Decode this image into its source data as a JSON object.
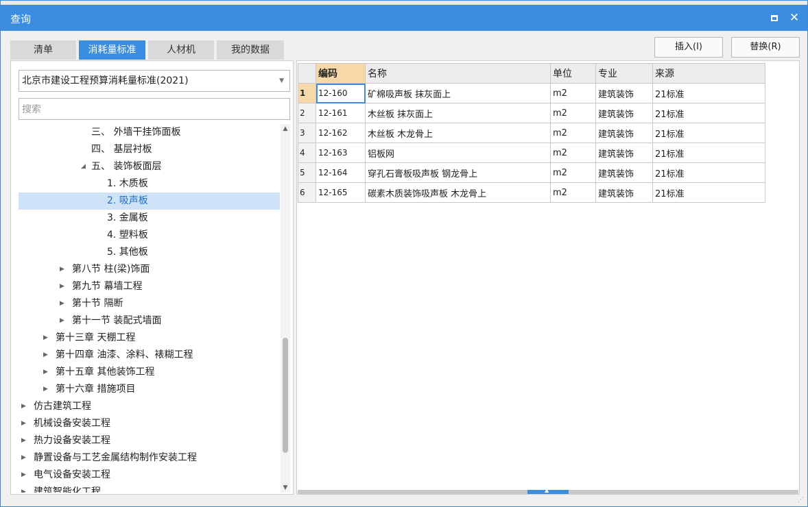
{
  "window": {
    "title": "查询"
  },
  "tabs": [
    "清单",
    "消耗量标准",
    "人材机",
    "我的数据"
  ],
  "buttons": {
    "insert": "插入(I)",
    "replace": "替换(R)"
  },
  "library": {
    "selected": "北京市建设工程预算消耗量标准(2021)"
  },
  "search": {
    "placeholder": "搜索"
  },
  "tree": [
    {
      "text": "三、 外墙干挂饰面板"
    },
    {
      "text": "四、 基层衬板"
    },
    {
      "text": "五、 装饰板面层",
      "expanded": true
    },
    {
      "text": "1. 木质板"
    },
    {
      "text": "2. 吸声板",
      "selected": true
    },
    {
      "text": "3. 金属板"
    },
    {
      "text": "4. 塑料板"
    },
    {
      "text": "5. 其他板"
    },
    {
      "text": "第八节 柱(梁)饰面"
    },
    {
      "text": "第九节 幕墙工程"
    },
    {
      "text": "第十节 隔断"
    },
    {
      "text": "第十一节 装配式墙面"
    },
    {
      "text": "第十三章 天棚工程"
    },
    {
      "text": "第十四章 油漆、涂料、裱糊工程"
    },
    {
      "text": "第十五章 其他装饰工程"
    },
    {
      "text": "第十六章 措施项目"
    },
    {
      "text": "仿古建筑工程"
    },
    {
      "text": "机械设备安装工程"
    },
    {
      "text": "热力设备安装工程"
    },
    {
      "text": "静置设备与工艺金属结构制作安装工程"
    },
    {
      "text": "电气设备安装工程"
    },
    {
      "text": "建筑智能化工程"
    }
  ],
  "table": {
    "columns": [
      "编码",
      "名称",
      "单位",
      "专业",
      "来源"
    ],
    "rows": [
      {
        "num": "1",
        "code": "12-160",
        "name": "矿棉吸声板 抹灰面上",
        "unit": "m2",
        "major": "建筑装饰",
        "source": "21标准"
      },
      {
        "num": "2",
        "code": "12-161",
        "name": "木丝板 抹灰面上",
        "unit": "m2",
        "major": "建筑装饰",
        "source": "21标准"
      },
      {
        "num": "3",
        "code": "12-162",
        "name": "木丝板 木龙骨上",
        "unit": "m2",
        "major": "建筑装饰",
        "source": "21标准"
      },
      {
        "num": "4",
        "code": "12-163",
        "name": "铝板网",
        "unit": "m2",
        "major": "建筑装饰",
        "source": "21标准"
      },
      {
        "num": "5",
        "code": "12-164",
        "name": "穿孔石膏板吸声板 钢龙骨上",
        "unit": "m2",
        "major": "建筑装饰",
        "source": "21标准"
      },
      {
        "num": "6",
        "code": "12-165",
        "name": "碳素木质装饰吸声板 木龙骨上",
        "unit": "m2",
        "major": "建筑装饰",
        "source": "21标准"
      }
    ]
  },
  "colors": {
    "accent": "#3a8de0",
    "header_highlight": "#f7d9a9",
    "selection": "#cfe3f8"
  }
}
